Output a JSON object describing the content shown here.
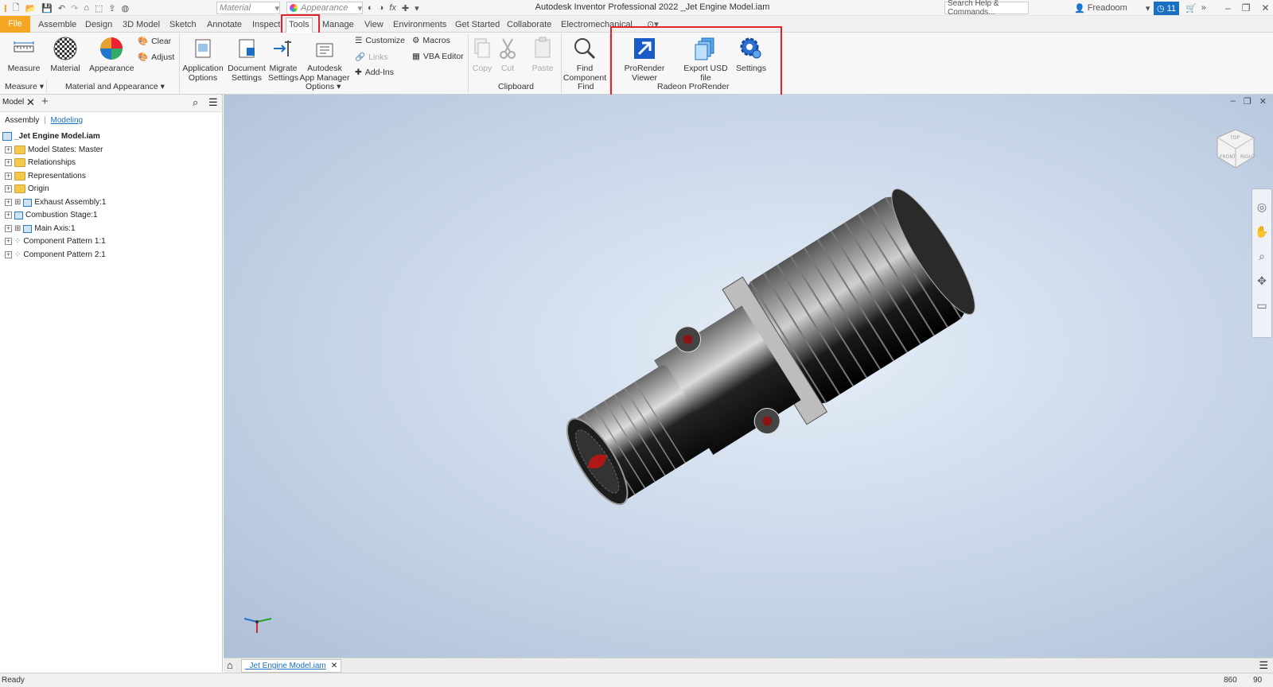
{
  "titlebar": {
    "title": "Autodesk Inventor Professional 2022   _Jet Engine Model.iam",
    "material_placeholder": "Material",
    "appearance_placeholder": "Appearance",
    "search_placeholder": "Search Help & Commands...",
    "user": "Freadoom",
    "notification_count": "11"
  },
  "tabs": [
    "File",
    "Assemble",
    "Design",
    "3D Model",
    "Sketch",
    "Annotate",
    "Inspect",
    "Tools",
    "Manage",
    "View",
    "Environments",
    "Get Started",
    "Collaborate",
    "Electromechanical"
  ],
  "active_tab": "Tools",
  "ribbon": {
    "measure": {
      "label": "Measure",
      "group": "Measure"
    },
    "material": {
      "label": "Material"
    },
    "appearance": {
      "label": "Appearance"
    },
    "clear": "Clear",
    "adjust": "Adjust",
    "material_group": "Material and Appearance",
    "app_options": "Application Options",
    "doc_settings": "Document Settings",
    "migrate": "Migrate Settings",
    "app_manager": "Autodesk App Manager",
    "customize": "Customize",
    "macros": "Macros",
    "links": "Links",
    "vba": "VBA Editor",
    "addins": "Add-Ins",
    "options_group": "Options",
    "copy": "Copy",
    "cut": "Cut",
    "paste": "Paste",
    "clipboard_group": "Clipboard",
    "find_component": "Find Component",
    "find_group": "Find",
    "prorender_viewer": "ProRender Viewer",
    "export_usd": "Export USD file",
    "settings": "Settings",
    "prorender_group": "Radeon ProRender"
  },
  "browser": {
    "tab": "Model",
    "view_assembly": "Assembly",
    "view_modeling": "Modeling",
    "root": "_Jet Engine Model.iam",
    "items": [
      "Model States: Master",
      "Relationships",
      "Representations",
      "Origin",
      "Exhaust Assembly:1",
      "Combustion Stage:1",
      "Main Axis:1",
      "Component Pattern 1:1",
      "Component Pattern 2:1"
    ]
  },
  "doc_tab": "_Jet Engine Model.iam",
  "status": {
    "text": "Ready",
    "num1": "860",
    "num2": "90"
  },
  "colors": {
    "accent": "#f5a623",
    "highlight": "#e0242a",
    "link": "#1a6fc2"
  }
}
